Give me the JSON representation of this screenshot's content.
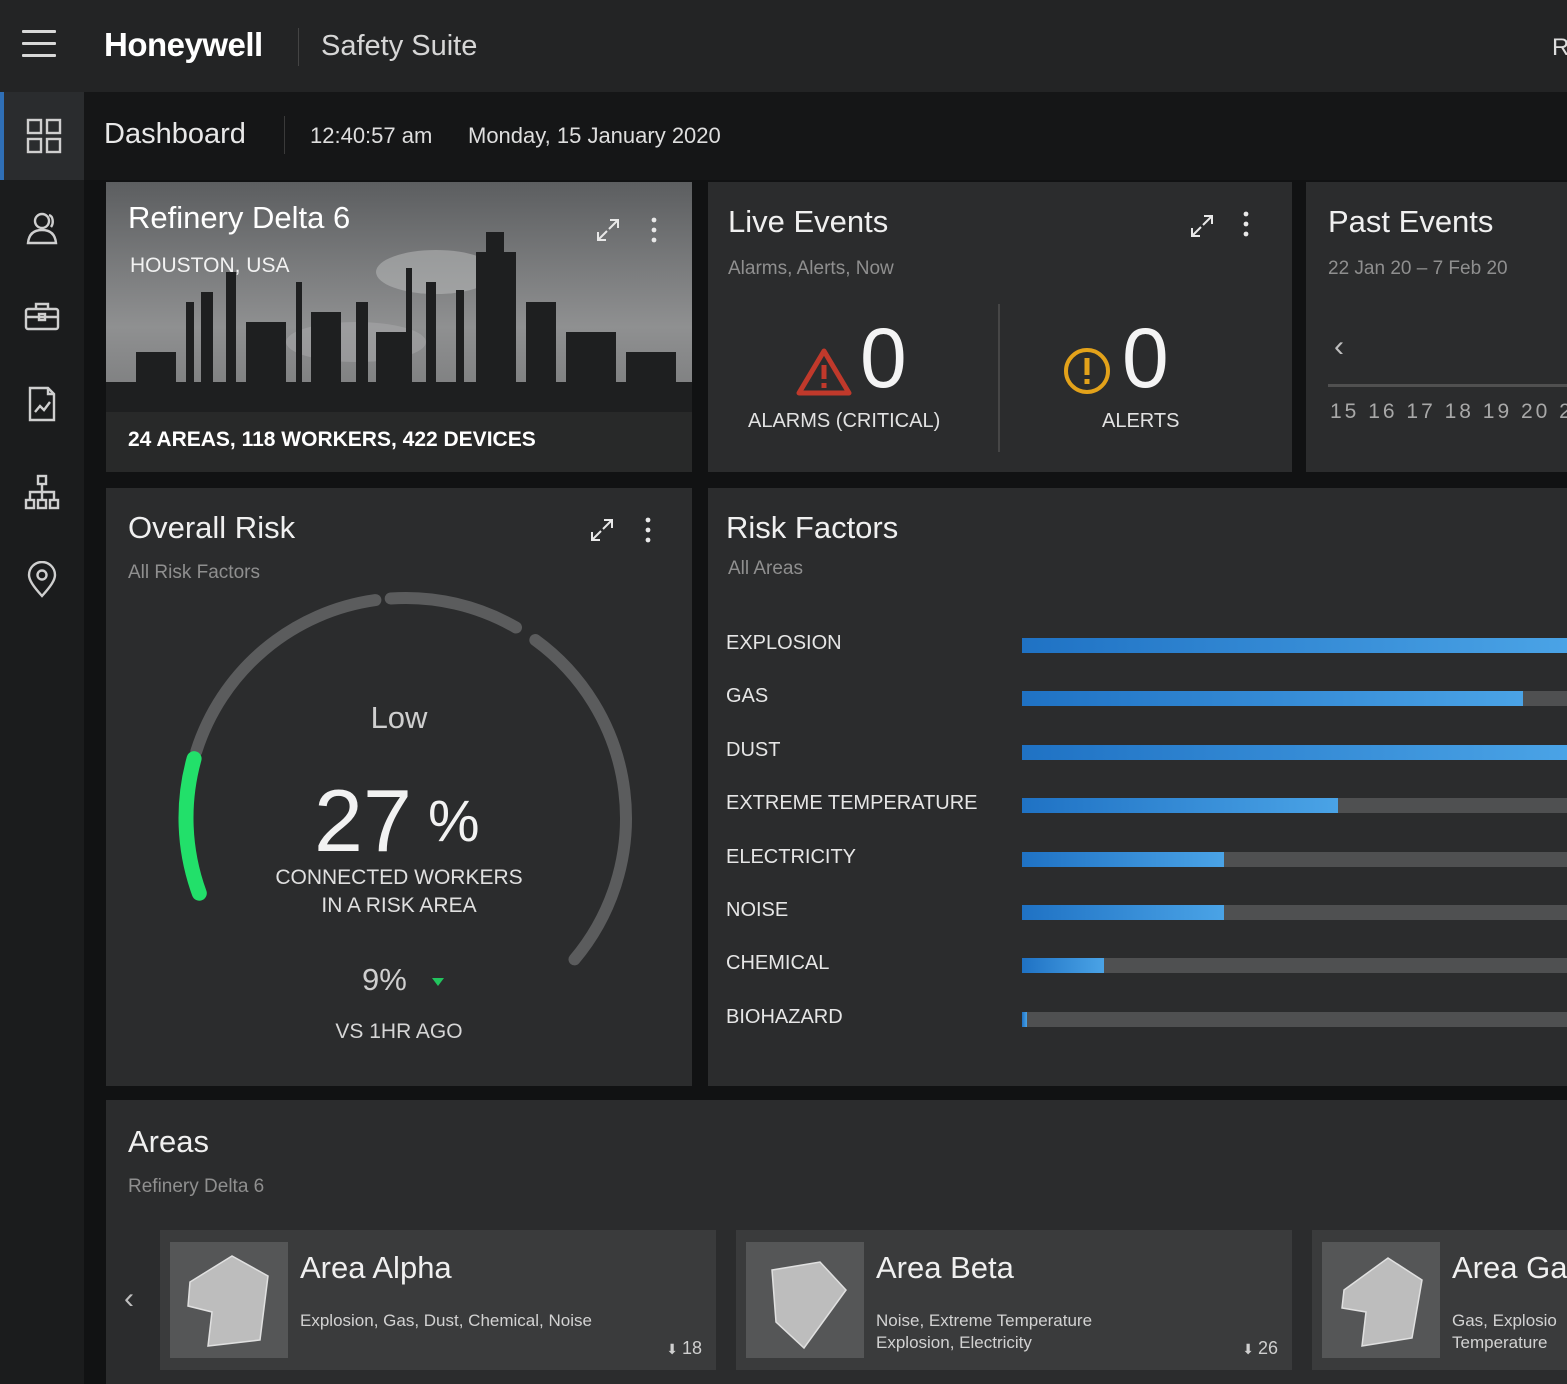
{
  "topbar": {
    "brand": "Honeywell",
    "app_name": "Safety Suite",
    "right_partial": "R"
  },
  "subheader": {
    "title": "Dashboard",
    "time": "12:40:57 am",
    "date": "Monday, 15 January 2020"
  },
  "sidebar": {
    "items": [
      {
        "icon": "dashboard-grid-icon",
        "active": true
      },
      {
        "icon": "people-icon"
      },
      {
        "icon": "toolbox-icon"
      },
      {
        "icon": "report-icon"
      },
      {
        "icon": "hierarchy-icon"
      },
      {
        "icon": "location-pin-icon"
      }
    ]
  },
  "refinery": {
    "title": "Refinery Delta 6",
    "location": "HOUSTON, USA",
    "stats": "24 AREAS, 118 WORKERS, 422 DEVICES"
  },
  "live_events": {
    "title": "Live Events",
    "subtitle": "Alarms, Alerts, Now",
    "alarms_value": "0",
    "alarms_label": "ALARMS (CRITICAL)",
    "alerts_value": "0",
    "alerts_label": "ALERTS"
  },
  "past_events": {
    "title": "Past Events",
    "subtitle": "22 Jan 20 – 7 Feb 20",
    "days": "15 16 17 18 19 20 2"
  },
  "overall_risk": {
    "title": "Overall Risk",
    "subtitle": "All Risk Factors",
    "level": "Low",
    "value": "27",
    "unit": "%",
    "caption_line1": "CONNECTED WORKERS",
    "caption_line2": "IN A RISK AREA",
    "delta": "9%",
    "delta_caption": "VS 1HR AGO",
    "gauge_fraction": 0.27,
    "colors": {
      "gauge_fill": "#22e06a",
      "gauge_track": "#5b5c5d"
    }
  },
  "risk_factors": {
    "title": "Risk Factors",
    "subtitle": "All Areas",
    "items": [
      {
        "label": "EXPLOSION",
        "fraction": 1.0
      },
      {
        "label": "GAS",
        "fraction": 0.92
      },
      {
        "label": "DUST",
        "fraction": 1.0
      },
      {
        "label": "EXTREME TEMPERATURE",
        "fraction": 0.58
      },
      {
        "label": "ELECTRICITY",
        "fraction": 0.37
      },
      {
        "label": "NOISE",
        "fraction": 0.37
      },
      {
        "label": "CHEMICAL",
        "fraction": 0.15
      },
      {
        "label": "BIOHAZARD",
        "fraction": 0.01
      }
    ]
  },
  "areas": {
    "title": "Areas",
    "subtitle": "Refinery Delta 6",
    "cards": [
      {
        "name": "Area Alpha",
        "risks": "Explosion, Gas, Dust, Chemical, Noise",
        "count": "18"
      },
      {
        "name": "Area Beta",
        "risks": "Noise, Extreme Temperature Explosion, Electricity",
        "count": "26"
      },
      {
        "name": "Area Ga",
        "risks": "Gas, Explosio Temperature",
        "count": ""
      }
    ]
  }
}
